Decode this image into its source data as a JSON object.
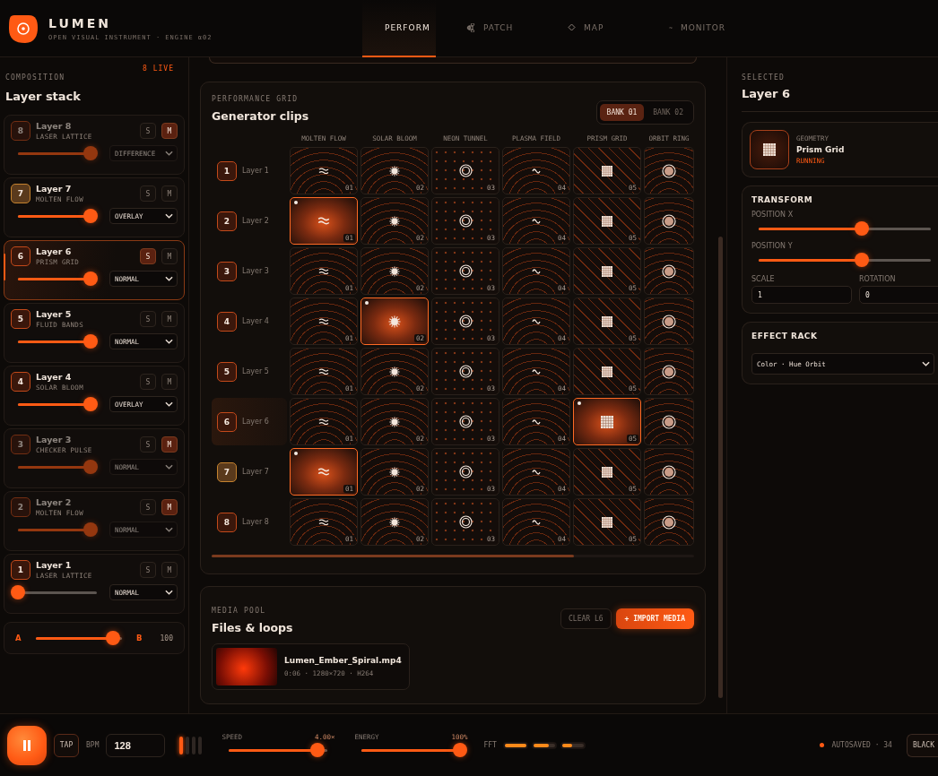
{
  "app": {
    "name": "LUMEN",
    "subtitle": "OPEN VISUAL INSTRUMENT · ENGINE α02"
  },
  "tabs": [
    {
      "label": "PERFORM",
      "selected": true
    },
    {
      "label": "PATCH",
      "selected": false
    },
    {
      "label": "MAP",
      "selected": false
    },
    {
      "label": "MONITOR",
      "selected": false
    }
  ],
  "composition": {
    "eyebrow": "COMPOSITION",
    "live": "8 LIVE",
    "title": "Layer stack",
    "layers": [
      {
        "number": "8",
        "name": "Layer 8",
        "generator": "LASER LATTICE",
        "solo": "S",
        "mute": "M",
        "soloed": false,
        "muted": true,
        "selected": false,
        "cued": false,
        "level": 0.92,
        "blend": "DIFFERENCE"
      },
      {
        "number": "7",
        "name": "Layer 7",
        "generator": "MOLTEN FLOW",
        "solo": "S",
        "mute": "M",
        "soloed": false,
        "muted": false,
        "selected": false,
        "cued": true,
        "level": 0.92,
        "blend": "OVERLAY"
      },
      {
        "number": "6",
        "name": "Layer 6",
        "generator": "PRISM GRID",
        "solo": "S",
        "mute": "M",
        "soloed": true,
        "muted": false,
        "selected": true,
        "cued": false,
        "level": 0.92,
        "blend": "NORMAL"
      },
      {
        "number": "5",
        "name": "Layer 5",
        "generator": "FLUID BANDS",
        "solo": "S",
        "mute": "M",
        "soloed": false,
        "muted": false,
        "selected": false,
        "cued": false,
        "level": 0.92,
        "blend": "NORMAL"
      },
      {
        "number": "4",
        "name": "Layer 4",
        "generator": "SOLAR BLOOM",
        "solo": "S",
        "mute": "M",
        "soloed": false,
        "muted": false,
        "selected": false,
        "cued": false,
        "level": 0.92,
        "blend": "OVERLAY"
      },
      {
        "number": "3",
        "name": "Layer 3",
        "generator": "CHECKER PULSE",
        "solo": "S",
        "mute": "M",
        "soloed": false,
        "muted": true,
        "selected": false,
        "cued": false,
        "level": 0.92,
        "blend": "NORMAL"
      },
      {
        "number": "2",
        "name": "Layer 2",
        "generator": "MOLTEN FLOW",
        "solo": "S",
        "mute": "M",
        "soloed": false,
        "muted": true,
        "selected": false,
        "cued": false,
        "level": 0.92,
        "blend": "NORMAL"
      },
      {
        "number": "1",
        "name": "Layer 1",
        "generator": "LASER LATTICE",
        "solo": "S",
        "mute": "M",
        "soloed": false,
        "muted": false,
        "selected": false,
        "cued": false,
        "level": 0,
        "blend": "NORMAL"
      }
    ],
    "crossfader": {
      "a": "A",
      "b": "B",
      "level": 0.9,
      "reading": "100"
    }
  },
  "grid": {
    "eyebrow": "PERFORMANCE GRID",
    "title": "Generator clips",
    "banks": [
      {
        "label": "BANK 01",
        "selected": true
      },
      {
        "label": "BANK 02",
        "selected": false
      }
    ],
    "columns": [
      {
        "label": "MOLTEN FLOW",
        "kind": "waves"
      },
      {
        "label": "SOLAR BLOOM",
        "kind": "bloom"
      },
      {
        "label": "NEON TUNNEL",
        "kind": "tunnel"
      },
      {
        "label": "PLASMA FIELD",
        "kind": "plasma"
      },
      {
        "label": "PRISM GRID",
        "kind": "grid"
      },
      {
        "label": "ORBIT RING",
        "kind": "orbit"
      }
    ],
    "rows": [
      {
        "number": "1",
        "label": "Layer 1",
        "selected": false,
        "cued": false,
        "clips": [
          {
            "code": "01",
            "active": false
          },
          {
            "code": "02",
            "active": false
          },
          {
            "code": "03",
            "active": false
          },
          {
            "code": "04",
            "active": false
          },
          {
            "code": "05",
            "active": false
          },
          {
            "active": false
          }
        ]
      },
      {
        "number": "2",
        "label": "Layer 2",
        "selected": false,
        "cued": false,
        "clips": [
          {
            "code": "01",
            "active": true
          },
          {
            "code": "02",
            "active": false
          },
          {
            "code": "03",
            "active": false
          },
          {
            "code": "04",
            "active": false
          },
          {
            "code": "05",
            "active": false
          },
          {
            "active": false
          }
        ]
      },
      {
        "number": "3",
        "label": "Layer 3",
        "selected": false,
        "cued": false,
        "clips": [
          {
            "code": "01",
            "active": false
          },
          {
            "code": "02",
            "active": false
          },
          {
            "code": "03",
            "active": false
          },
          {
            "code": "04",
            "active": false
          },
          {
            "code": "05",
            "active": false
          },
          {
            "active": false
          }
        ]
      },
      {
        "number": "4",
        "label": "Layer 4",
        "selected": false,
        "cued": false,
        "clips": [
          {
            "code": "01",
            "active": false
          },
          {
            "code": "02",
            "active": true
          },
          {
            "code": "03",
            "active": false
          },
          {
            "code": "04",
            "active": false
          },
          {
            "code": "05",
            "active": false
          },
          {
            "active": false
          }
        ]
      },
      {
        "number": "5",
        "label": "Layer 5",
        "selected": false,
        "cued": false,
        "clips": [
          {
            "code": "01",
            "active": false
          },
          {
            "code": "02",
            "active": false
          },
          {
            "code": "03",
            "active": false
          },
          {
            "code": "04",
            "active": false
          },
          {
            "code": "05",
            "active": false
          },
          {
            "active": false
          }
        ]
      },
      {
        "number": "6",
        "label": "Layer 6",
        "selected": true,
        "cued": false,
        "clips": [
          {
            "code": "01",
            "active": false
          },
          {
            "code": "02",
            "active": false
          },
          {
            "code": "03",
            "active": false
          },
          {
            "code": "04",
            "active": false
          },
          {
            "code": "05",
            "active": true
          },
          {
            "active": false
          }
        ]
      },
      {
        "number": "7",
        "label": "Layer 7",
        "selected": false,
        "cued": true,
        "clips": [
          {
            "code": "01",
            "active": true
          },
          {
            "code": "02",
            "active": false
          },
          {
            "code": "03",
            "active": false
          },
          {
            "code": "04",
            "active": false
          },
          {
            "code": "05",
            "active": false
          },
          {
            "active": false
          }
        ]
      },
      {
        "number": "8",
        "label": "Layer 8",
        "selected": false,
        "cued": false,
        "clips": [
          {
            "code": "01",
            "active": false
          },
          {
            "code": "02",
            "active": false
          },
          {
            "code": "03",
            "active": false
          },
          {
            "code": "04",
            "active": false
          },
          {
            "code": "05",
            "active": false
          },
          {
            "active": false
          }
        ]
      }
    ]
  },
  "media": {
    "eyebrow": "MEDIA POOL",
    "title": "Files & loops",
    "clear": "CLEAR L6",
    "import": "+ IMPORT MEDIA",
    "files": [
      {
        "name": "Lumen_Ember_Spiral.mp4",
        "meta": "0:06 · 1280×720 · H264"
      }
    ]
  },
  "inspector": {
    "eyebrow": "SELECTED",
    "title": "Layer 6",
    "generator": {
      "category": "GEOMETRY",
      "name": "Prism Grid",
      "status": "RUNNING"
    },
    "transform": {
      "title": "TRANSFORM",
      "sliders": [
        {
          "label": "POSITION X",
          "level": 0.6
        },
        {
          "label": "POSITION Y",
          "level": 0.6
        }
      ],
      "fields": [
        {
          "label": "SCALE",
          "value": "1"
        },
        {
          "label": "ROTATION",
          "value": "0"
        }
      ]
    },
    "effects": {
      "title": "EFFECT RACK",
      "selected": "Color · Hue Orbit"
    }
  },
  "transport": {
    "playing": true,
    "tap": "TAP",
    "bpm_label": "BPM",
    "bpm": "128",
    "beats": [
      {
        "on": true
      },
      {
        "on": false
      },
      {
        "on": false
      },
      {
        "on": false
      }
    ],
    "speed": {
      "label": "SPEED",
      "reading": "4.00×",
      "level": 0.9
    },
    "energy": {
      "label": "ENERGY",
      "reading": "100%",
      "level": 1
    },
    "fft": {
      "label": "FFT",
      "bands": [
        {
          "level": 1
        },
        {
          "level": 0.72
        },
        {
          "level": 0.45
        }
      ]
    },
    "status": "AUTOSAVED · 34",
    "blackout": "BLACK"
  }
}
